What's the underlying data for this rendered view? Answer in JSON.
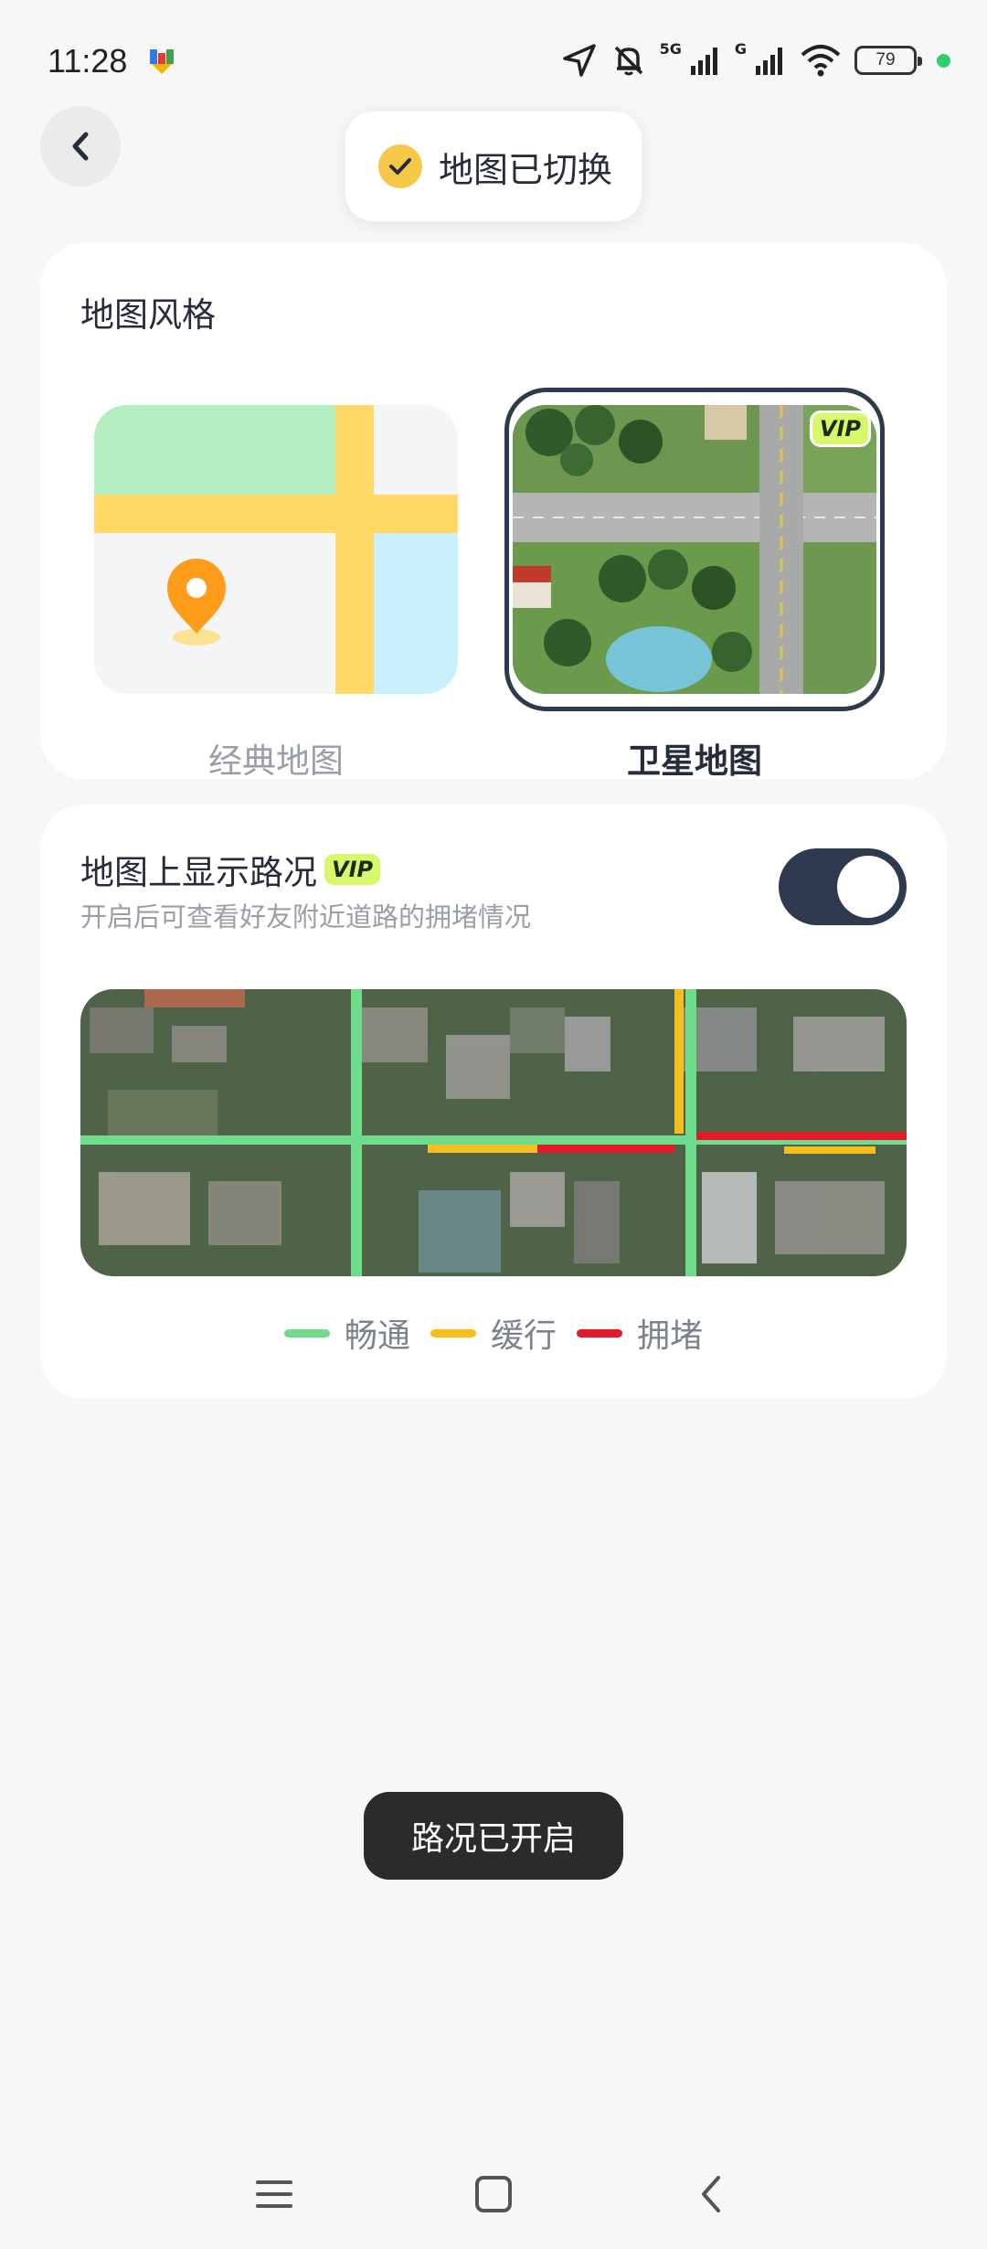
{
  "status_bar": {
    "time": "11:28",
    "network_labels": [
      "5G",
      "G"
    ],
    "battery": "79",
    "icons": [
      "app-notification-icon",
      "location-arrow-icon",
      "mute-bell-icon",
      "signal-5g-icon",
      "signal-g-icon",
      "wifi-icon",
      "battery-icon",
      "privacy-dot-icon"
    ]
  },
  "header": {
    "back_icon": "chevron-left-icon"
  },
  "toast_top": {
    "icon": "check-circle-icon",
    "text": "地图已切换"
  },
  "map_style": {
    "title": "地图风格",
    "options": [
      {
        "label": "经典地图",
        "selected": false,
        "vip": false
      },
      {
        "label": "卫星地图",
        "selected": true,
        "vip": true
      }
    ],
    "vip_badge": "VIP"
  },
  "traffic": {
    "title": "地图上显示路况",
    "vip_badge": "VIP",
    "subtitle": "开启后可查看好友附近道路的拥堵情况",
    "enabled": true,
    "legend": [
      {
        "label": "畅通",
        "color": "#6fdc8c"
      },
      {
        "label": "缓行",
        "color": "#f4bf1f"
      },
      {
        "label": "拥堵",
        "color": "#e3192c"
      }
    ]
  },
  "toast_bottom": {
    "text": "路况已开启"
  },
  "nav_bar": {
    "icons": [
      "menu-icon",
      "home-square-icon",
      "back-chevron-icon"
    ]
  },
  "colors": {
    "accent_dark": "#2f3a4f",
    "vip_green": "#d9f76a",
    "check_yellow": "#f6c847",
    "background": "#f7f7f7"
  }
}
